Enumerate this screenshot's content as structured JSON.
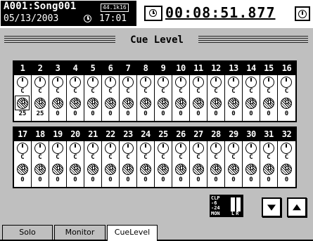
{
  "header": {
    "song_name": "A001:Song001",
    "sample_format": "44.1k16",
    "date": "05/13/2003",
    "time": "17:01",
    "counter": "00:08:51.877"
  },
  "page": {
    "title": "Cue Level"
  },
  "channels": [
    {
      "num": "1",
      "pan": "C",
      "level": "25"
    },
    {
      "num": "2",
      "pan": "C",
      "level": "25"
    },
    {
      "num": "3",
      "pan": "C",
      "level": "0"
    },
    {
      "num": "4",
      "pan": "C",
      "level": "0"
    },
    {
      "num": "5",
      "pan": "C",
      "level": "0"
    },
    {
      "num": "6",
      "pan": "C",
      "level": "0"
    },
    {
      "num": "7",
      "pan": "C",
      "level": "0"
    },
    {
      "num": "8",
      "pan": "C",
      "level": "0"
    },
    {
      "num": "9",
      "pan": "C",
      "level": "0"
    },
    {
      "num": "10",
      "pan": "C",
      "level": "0"
    },
    {
      "num": "11",
      "pan": "C",
      "level": "0"
    },
    {
      "num": "12",
      "pan": "C",
      "level": "0"
    },
    {
      "num": "13",
      "pan": "C",
      "level": "0"
    },
    {
      "num": "14",
      "pan": "C",
      "level": "0"
    },
    {
      "num": "15",
      "pan": "C",
      "level": "0"
    },
    {
      "num": "16",
      "pan": "C",
      "level": "0"
    },
    {
      "num": "17",
      "pan": "C",
      "level": "0"
    },
    {
      "num": "18",
      "pan": "C",
      "level": "0"
    },
    {
      "num": "19",
      "pan": "C",
      "level": "0"
    },
    {
      "num": "20",
      "pan": "C",
      "level": "0"
    },
    {
      "num": "21",
      "pan": "C",
      "level": "0"
    },
    {
      "num": "22",
      "pan": "C",
      "level": "0"
    },
    {
      "num": "23",
      "pan": "C",
      "level": "0"
    },
    {
      "num": "24",
      "pan": "C",
      "level": "0"
    },
    {
      "num": "25",
      "pan": "C",
      "level": "0"
    },
    {
      "num": "26",
      "pan": "C",
      "level": "0"
    },
    {
      "num": "27",
      "pan": "C",
      "level": "0"
    },
    {
      "num": "28",
      "pan": "C",
      "level": "0"
    },
    {
      "num": "29",
      "pan": "C",
      "level": "0"
    },
    {
      "num": "30",
      "pan": "C",
      "level": "0"
    },
    {
      "num": "31",
      "pan": "C",
      "level": "0"
    },
    {
      "num": "32",
      "pan": "C",
      "level": "0"
    }
  ],
  "selected_channel": "1",
  "meter": {
    "scale": "CLP\n-6\n-24",
    "mon_label": "MON",
    "lr_label": "LR"
  },
  "icons": {
    "clock": "clock-icon",
    "counter": "counter-clock-icon",
    "mtc": "mtc-clock-icon",
    "down": "arrow-down-icon",
    "up": "arrow-up-icon"
  },
  "tabs": [
    "Solo",
    "Monitor",
    "CueLevel"
  ],
  "active_tab": "CueLevel"
}
